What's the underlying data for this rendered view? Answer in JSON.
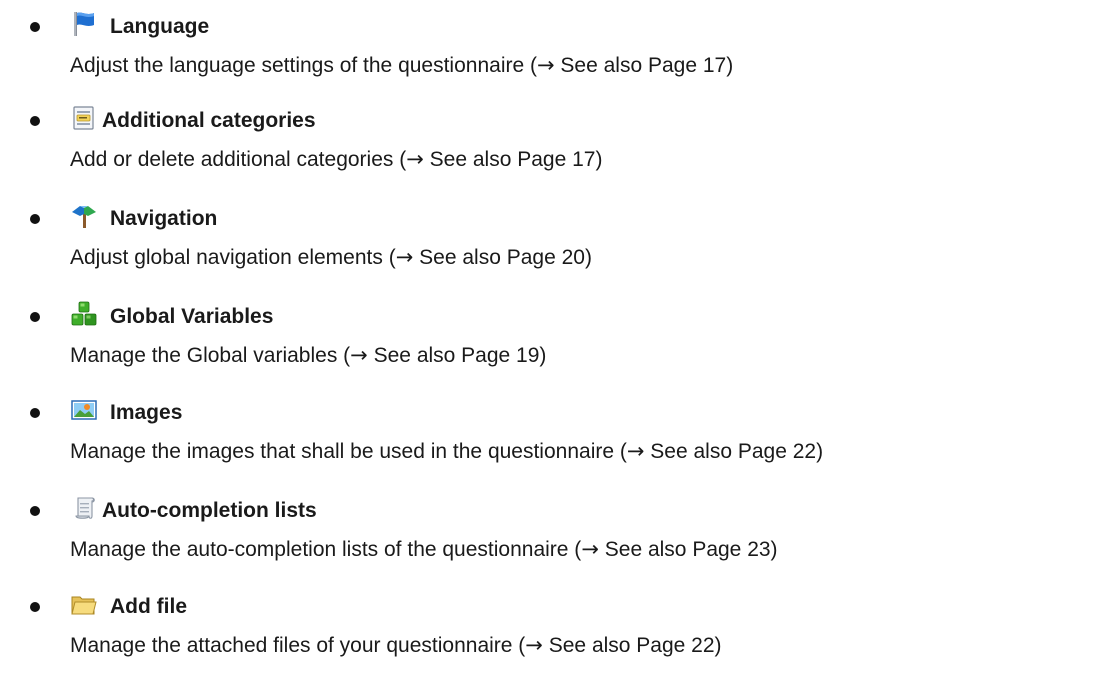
{
  "items": [
    {
      "icon": "blue-flag-icon",
      "title": "Language",
      "desc_before": "Adjust the language settings of the questionnaire (",
      "arrow": "→",
      "desc_after": " See also Page 17)"
    },
    {
      "icon": "document-category-icon",
      "title": "Additional categories",
      "desc_before": "Add or delete additional categories (",
      "arrow": "→",
      "desc_after": " See also Page 17)"
    },
    {
      "icon": "navigation-signpost-icon",
      "title": "Navigation",
      "desc_before": "Adjust global navigation elements (",
      "arrow": "→",
      "desc_after": " See also Page 20)"
    },
    {
      "icon": "green-cubes-icon",
      "title": "Global Variables",
      "desc_before": "Manage the Global variables (",
      "arrow": "→",
      "desc_after": " See also Page 19)"
    },
    {
      "icon": "picture-icon",
      "title": "Images",
      "desc_before": "Manage the images that shall be used in the questionnaire (",
      "arrow": "→",
      "desc_after": " See also Page 22)"
    },
    {
      "icon": "scroll-list-icon",
      "title": "Auto-completion lists",
      "desc_before": "Manage the auto-completion lists of the questionnaire (",
      "arrow": "→",
      "desc_after": " See also Page 23)"
    },
    {
      "icon": "folder-icon",
      "title": "Add file",
      "desc_before": "Manage the attached files of your questionnaire (",
      "arrow": "→",
      "desc_after": " See also Page 22)"
    }
  ]
}
